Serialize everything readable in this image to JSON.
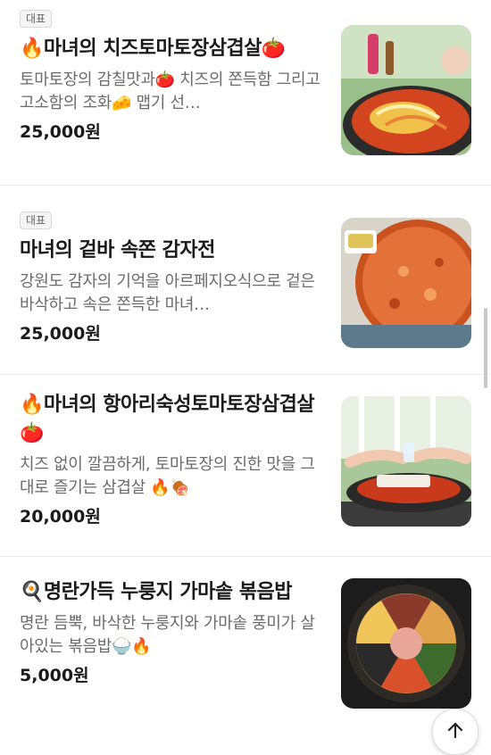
{
  "menu": {
    "items": [
      {
        "badge": "대표",
        "name": "🔥마녀의 치즈토마토장삼겹살🍅",
        "description": "토마토장의 감칠맛과🍅 치즈의 쫀득함 그리고 고소함의 조화🧀 맵기 선…",
        "price": "25,000원",
        "image_icon": "cheese-tomato-pork-photo"
      },
      {
        "badge": "대표",
        "name": "마녀의 겉바 속쫀 감자전",
        "description": "강원도 감자의 기억을 아르페지오식으로 겉은 바삭하고 속은 쫀득한 마녀…",
        "price": "25,000원",
        "image_icon": "potato-pancake-photo"
      },
      {
        "badge": "",
        "name": "🔥마녀의 항아리숙성토마토장삼겹살🍅",
        "description": "치즈 없이 깔끔하게, 토마토장의 진한 맛을 그대로 즐기는 삼겹살 🔥🍖",
        "price": "20,000원",
        "image_icon": "jar-aged-pork-photo"
      },
      {
        "badge": "",
        "name": "🍳명란가득 누룽지 가마솥 볶음밥",
        "description": "명란 듬뿍, 바삭한 누룽지와 가마솥 풍미가 살아있는 볶음밥🍚🔥",
        "price": "5,000원",
        "image_icon": "fried-rice-pot-photo"
      }
    ]
  },
  "scroll_top_icon": "arrow-up-icon",
  "colors": {
    "text": "#1a1a1a",
    "muted": "#6b6b6b",
    "badge_bg": "#f4f4f4",
    "divider": "#ececec"
  }
}
